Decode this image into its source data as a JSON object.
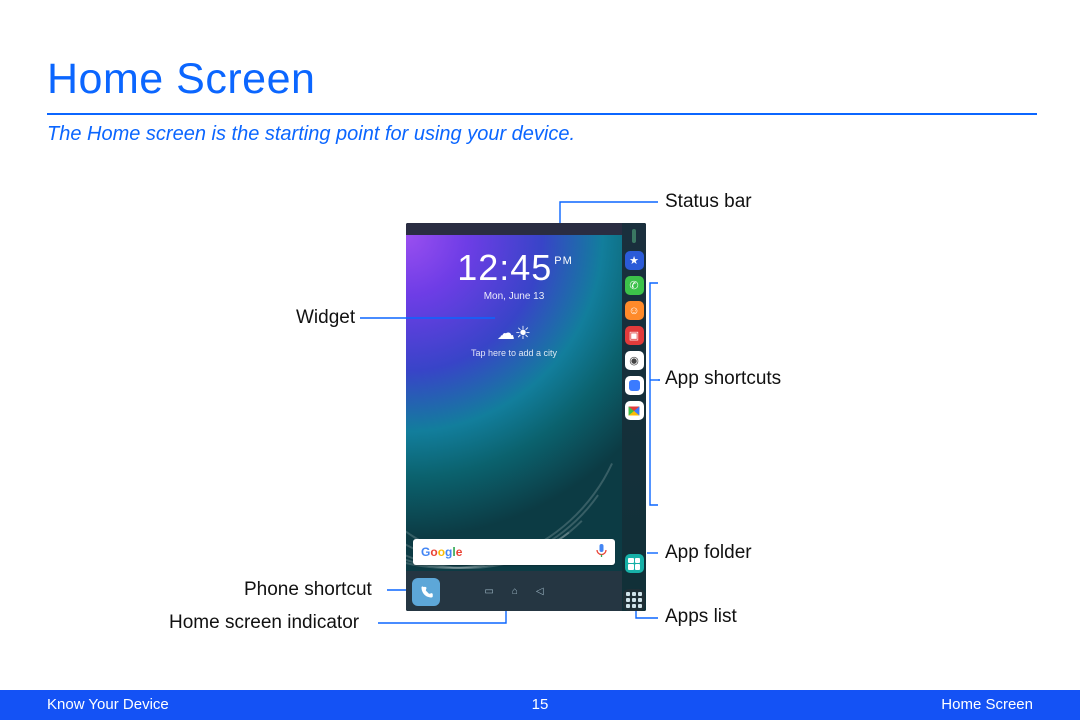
{
  "header": {
    "title": "Home Screen",
    "intro": "The Home screen is the starting point for using your device."
  },
  "footer": {
    "left": "Know Your Device",
    "page": "15",
    "right": "Home Screen"
  },
  "callouts": {
    "status_bar": "Status bar",
    "app_shortcuts": "App shortcuts",
    "app_folder": "App folder",
    "apps_list": "Apps list",
    "widget": "Widget",
    "phone_shortcut": "Phone shortcut",
    "home_indicator": "Home screen indicator"
  },
  "device": {
    "clock_time": "12:45",
    "clock_suffix": "PM",
    "clock_date": "Mon, June 13",
    "weather_hint": "Tap here to add a city",
    "search_brand": "Google",
    "edge_icons": [
      "star-icon",
      "phone-icon",
      "contacts-icon",
      "galaxy-apps-icon",
      "chrome-icon",
      "messages-icon",
      "play-store-icon",
      "app-folder-icon"
    ],
    "apps_list_icon": "apps-grid-icon"
  }
}
